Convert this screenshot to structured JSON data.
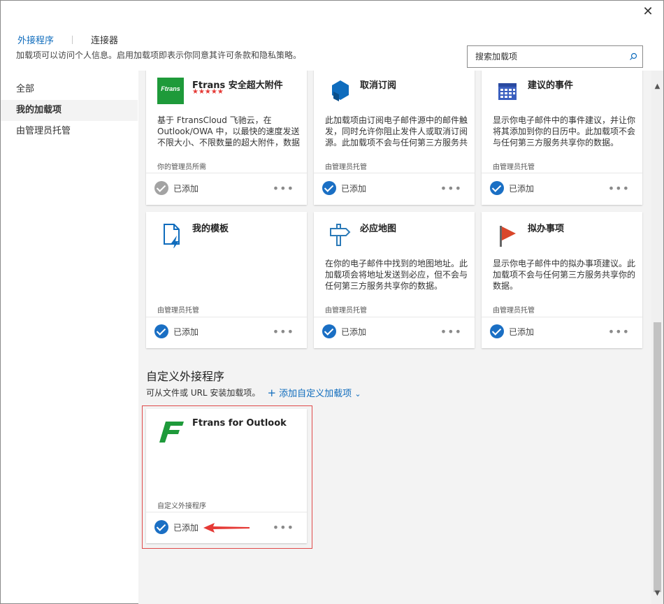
{
  "window": {
    "close_label": "✕"
  },
  "tabs": [
    {
      "label": "外接程序"
    },
    {
      "label": "连接器"
    }
  ],
  "subtitle": "加载项可以访问个人信息。启用加载项即表示你同意其许可条款和隐私策略。",
  "search": {
    "placeholder": "搜索加载项"
  },
  "sidebar": {
    "items": [
      {
        "label": "全部"
      },
      {
        "label": "我的加载项"
      },
      {
        "label": "由管理员托管"
      }
    ]
  },
  "cards": [
    {
      "name": "Ftrans 安全超大附件",
      "stars": "★★★★★",
      "icon": "ftrans-logo-icon",
      "icon_text": "Ftrans",
      "desc": "基于 FtransCloud 飞驰云，在 Outlook/OWA 中，以最快的速度发送不限大小、不限数量的超大附件，数据",
      "owner": "你的管理员所需",
      "status": "已添加",
      "more": "•••"
    },
    {
      "name": "取消订阅",
      "icon": "hexagon-icon",
      "desc": "此加载项由订阅电子邮件源中的邮件触发，同时允许你阻止发件人或取消订阅源。此加载项不会与任何第三方服务共",
      "owner": "由管理员托管",
      "status": "已添加",
      "more": "•••"
    },
    {
      "name": "建议的事件",
      "icon": "calendar-icon",
      "desc": "显示你电子邮件中的事件建议，并让你将其添加到你的日历中。此加载项不会与任何第三方服务共享你的数据。",
      "owner": "由管理员托管",
      "status": "已添加",
      "more": "•••"
    },
    {
      "name": "我的模板",
      "icon": "template-icon",
      "desc": "",
      "owner": "由管理员托管",
      "status": "已添加",
      "more": "•••"
    },
    {
      "name": "必应地图",
      "icon": "signpost-icon",
      "desc": "在你的电子邮件中找到的地图地址。此加载项会将地址发送到必应，但不会与任何第三方服务共享你的数据。",
      "owner": "由管理员托管",
      "status": "已添加",
      "more": "•••"
    },
    {
      "name": "拟办事项",
      "icon": "flag-icon",
      "desc": "显示你电子邮件中的拟办事项建议。此加载项不会与任何第三方服务共享你的数据。",
      "owner": "由管理员托管",
      "status": "已添加",
      "more": "•••"
    }
  ],
  "custom": {
    "title": "自定义外接程序",
    "subtitle": "可从文件或 URL 安装加载项。",
    "add_label": "添加自定义加载项",
    "card": {
      "name": "Ftrans for Outlook",
      "icon": "ftrans-f-icon",
      "owner": "自定义外接程序",
      "status": "已添加",
      "more": "•••"
    }
  },
  "colors": {
    "accent": "#0f6cbd",
    "check": "#1a6fc4",
    "highlight": "#e04a4a",
    "ftrans_green": "#1e9a3a"
  }
}
